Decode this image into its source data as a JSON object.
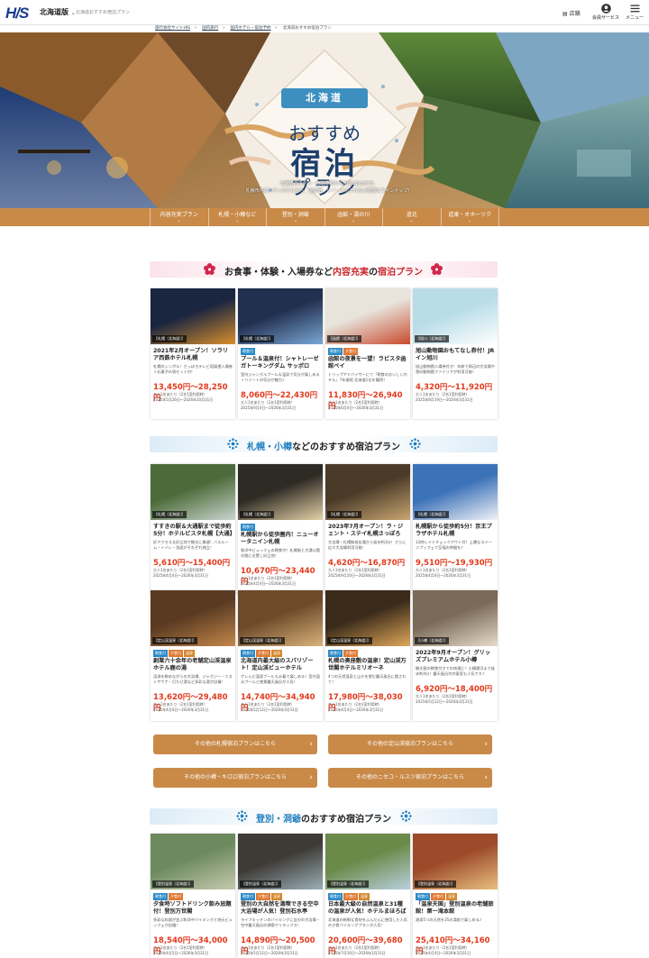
{
  "header": {
    "logo": "H/S",
    "region": "北海道版",
    "region_chevron": "⌄",
    "tagline": "北海道おすすめ宿泊プラン",
    "store_label": "店舗",
    "member_label": "会員サービス",
    "menu_label": "メニュー"
  },
  "breadcrumb": [
    "旅行会社サイトHIS",
    "国内旅行",
    "国内ホテル・宿泊予約",
    "北海道おすすめ宿泊プラン"
  ],
  "hero": {
    "badge": "北海道",
    "title_line1": "おすすめ",
    "title_line2": "宿泊",
    "title_line3": "プラン",
    "description_line1": "北海道のホテル・宿泊予約ならHISにおまかせ。",
    "description_line2": "札幌市内のシティホテルから、温泉宿、リゾートホテルなど豊富なラインナップ！"
  },
  "category_nav": [
    "内容充実プラン",
    "札幌・小樽など",
    "登別・洞爺",
    "函館・湯の川",
    "道北",
    "道東・オホーツク"
  ],
  "nav_chevron": "⌄",
  "sections": {
    "s1": {
      "prefix": "お食事・体験・入場券など",
      "highlight": "内容充実",
      "mid": "の",
      "highlight2": "宿泊プラン"
    },
    "s2": {
      "highlight": "札幌・小樽",
      "suffix": "などのおすすめ宿泊プラン"
    },
    "s3": {
      "highlight": "登別・洞爺",
      "suffix": "のおすすめ宿泊プラン"
    }
  },
  "cards": [
    {
      "tag": "【札幌（北海道）】",
      "badges": [],
      "name": "2021年2月オープン！ソラリア西鉄ホテル札幌",
      "desc": "札幌のシンボル！さっぽろテレビ塔展望入場券＋お菓子の袋セット付！",
      "price": "13,450円〜28,250円",
      "cond1": "大人1名あたり（2名1室利用時）",
      "cond2": "2025年5月26日〜2026年10月31日"
    },
    {
      "tag": "【札幌（北海道）】",
      "badges": [
        "朝食付"
      ],
      "name": "プール＆温泉付！シャトレーゼ ガトーキングダム サッポロ",
      "desc": "室内ジャングルプール＆温泉で気分が楽しめる＋リゾートの気分が魅力♪",
      "price": "8,060円〜22,430円",
      "cond1": "大人1名あたり（2名1室利用時）",
      "cond2": "2025年9月4日〜2026年3月31日"
    },
    {
      "tag": "【函館（北海道）】",
      "badges": [
        "朝食付",
        "夕食付"
      ],
      "name": "函館の夜景を一望！ラビスタ函館ベイ",
      "desc": "トリップアドバイザーにて「朝食のおいしいホテル」7年連続 北海道1位を獲得！",
      "price": "11,830円〜26,940円",
      "cond1": "大人1名あたり（2名1室利用時）",
      "cond2": "2025年6月4日〜2026年3月31日"
    },
    {
      "tag": "【旭川（北海道）】",
      "badges": [],
      "name": "旭山動物園おもてなし券付！JRイン旭川",
      "desc": "旭山動物園入場券付き！年齢で周辺の大浴場や雪印動物園ファミリアが利用可能！",
      "price": "4,320円〜11,920円",
      "cond1": "大人1名あたり（2名1室利用時）",
      "cond2": "2025年8月19日〜2026年3月31日"
    },
    {
      "tag": "【札幌（北海道）】",
      "badges": [],
      "name": "すすきの駅＆大通駅まで徒歩約5分！ホテルビスタ札幌【大通】",
      "desc": "好アクセス＆好立地で観光に最適！バスルーム・トイレ・洗面がそれぞれ独立！",
      "price": "5,610円〜15,400円",
      "cond1": "大人1名あたり（2名1室利用時）",
      "cond2": "2025年4月4日〜2026年3月31日"
    },
    {
      "tag": "【札幌（北海道）】",
      "badges": [
        "朝食付"
      ],
      "name": "札幌駅から徒歩圏内！ニューオータニイン札幌",
      "desc": "和洋中ビュッフェの朝食付！札幌駅と大通公園の間に位置し好立地！",
      "price": "10,670円〜23,440円",
      "cond1": "大人1名あたり（2名1室利用時）",
      "cond2": "2025年4月4日〜2026年3月31日"
    },
    {
      "tag": "【札幌（北海道）】",
      "badges": [],
      "name": "2023年7月オープン！ラ・ジェント・ステイ札幌さっぽろ",
      "desc": "大浴場・札幌駅前広場から徒歩約3分！さらに広々大浴場利用可能！",
      "price": "4,620円〜16,870円",
      "cond1": "大人1名あたり（2名1室利用時）",
      "cond2": "2025年9月10日〜2026年3月31日"
    },
    {
      "tag": "【札幌（北海道）】",
      "badges": [],
      "name": "札幌駅から徒歩約5分！京王プラザホテル札幌",
      "desc": "12時レイトチェックアウト付！上層なスイーツブッフェで至福の時間を♪",
      "price": "9,510円〜19,930円",
      "cond1": "大人1名あたり（2名1室利用時）",
      "cond2": "2025年4月4日〜2026年3月31日"
    },
    {
      "tag": "【定山渓温泉（北海道）】",
      "badges": [
        "朝食付",
        "夕食付",
        "温泉"
      ],
      "name": "創業六十余年の老舗定山渓温泉 ホテル鹿の湯",
      "desc": "渓流を眺めながらの大浴場、ジャグジー・ミストサウナ・打たせ湯など多彩な湯が自慢！",
      "price": "13,620円〜29,480円",
      "cond1": "大人1名あたり（2名1室利用時）",
      "cond2": "2025年4月4日〜2026年3月31日"
    },
    {
      "tag": "【定山渓温泉（北海道）】",
      "badges": [
        "朝食付",
        "夕食付",
        "温泉"
      ],
      "name": "北海道内最大級のスパリゾート！定山渓ビューホテル",
      "desc": "ゲレんだ温泉プールも水着で楽しめる！室内温水プールと絶景露天風呂が人気！",
      "price": "14,740円〜34,940円",
      "cond1": "大人1名あたり（2名1室利用時）",
      "cond2": "2025年5月12日〜2026年3月31日"
    },
    {
      "tag": "【定山渓温泉（北海道）】",
      "badges": [
        "朝食付",
        "夕食付"
      ],
      "name": "札幌の奥座敷の温泉！定山渓万世閣ホテルミリオーネ",
      "desc": "4つの天然温泉と山々を望む露天風呂に癒されて！",
      "price": "17,980円〜38,030円",
      "cond1": "大人1名あたり（2名1室利用時）",
      "cond2": "2025年4月4日〜2026年3月31日"
    },
    {
      "tag": "【小樽（北海道）】",
      "badges": [],
      "name": "2022年9月オープン！グリッズプレミアムホテル小樽",
      "desc": "観光客の朝食付きでの快適に！小樽運河まで徒歩約4分！露天風呂付の客室も人気です♪",
      "price": "6,920円〜18,400円",
      "cond1": "大人1名あたり（2名1室利用時）",
      "cond2": "2025年5月12日〜2026年3月31日"
    },
    {
      "tag": "【登別温泉（北海道）】",
      "badges": [
        "朝食付",
        "夕食付"
      ],
      "name": "夕食時ソフトドリンク飲み放題付！登別万世閣",
      "desc": "多彩な料理が並ぶ和洋中バイキングと地元ビュッフェが自慢！",
      "price": "18,540円〜34,000円",
      "cond1": "大人1名あたり（2名1室利用時）",
      "cond2": "2025年4月5日〜2026年3月31日"
    },
    {
      "tag": "【登別温泉（北海道）】",
      "badges": [
        "朝食付",
        "夕食付",
        "温泉"
      ],
      "name": "登別の大自然を満喫できる空中大浴場が人気！登別石水亭",
      "desc": "ライブキッチンのバイキングに自分の大浴場・空中露天風呂の満喫でリラックス！",
      "price": "14,890円〜20,500円",
      "cond1": "大人1名あたり（2名1室利用時）",
      "cond2": "2025年5月12日〜2026年3月31日"
    },
    {
      "tag": "【登別温泉（北海道）】",
      "badges": [
        "朝食付",
        "夕食付",
        "温泉"
      ],
      "name": "日本最大級の自然温泉と31種の温泉が人気！ホテルまほろば",
      "desc": "北海道の新鮮な食材をふんだんに使用した人気の夕食バイキングプランが人気！",
      "price": "20,600円〜39,680円",
      "cond1": "大人1名あたり（2名1室利用時）",
      "cond2": "2025年7月16日〜2026年3月31日"
    },
    {
      "tag": "【登別温泉（北海道）】",
      "badges": [
        "朝食付",
        "夕食付",
        "温泉"
      ],
      "name": "「温泉天国」登別温泉の老舗旅館！第一滝本館",
      "desc": "源泉5つの天然を35の湯船で楽しめる♪",
      "price": "25,410円〜34,160円",
      "cond1": "大人1名あたり（2名1室利用時）",
      "cond2": "2025年4月4日〜2026年3月31日"
    }
  ],
  "buttons": [
    "その他の札幌宿泊プランはこちら",
    "その他の定山渓宿泊プランはこちら",
    "その他の小樽・キロロ宿泊プランはこちら",
    "その他のニセコ・ルスツ宿泊プランはこちら"
  ],
  "button_arrow": "›",
  "icons": {
    "store": "store-icon",
    "member": "user-circle-icon",
    "menu": "hamburger-icon",
    "deco": "plum-blossom-icon",
    "snow": "snowflake-icon"
  },
  "colors": {
    "accent": "#c98a48",
    "brand": "#1b3d8f",
    "price": "#e2391c",
    "highlight": "#c9262c",
    "section_blue": "#1f7fbf"
  }
}
